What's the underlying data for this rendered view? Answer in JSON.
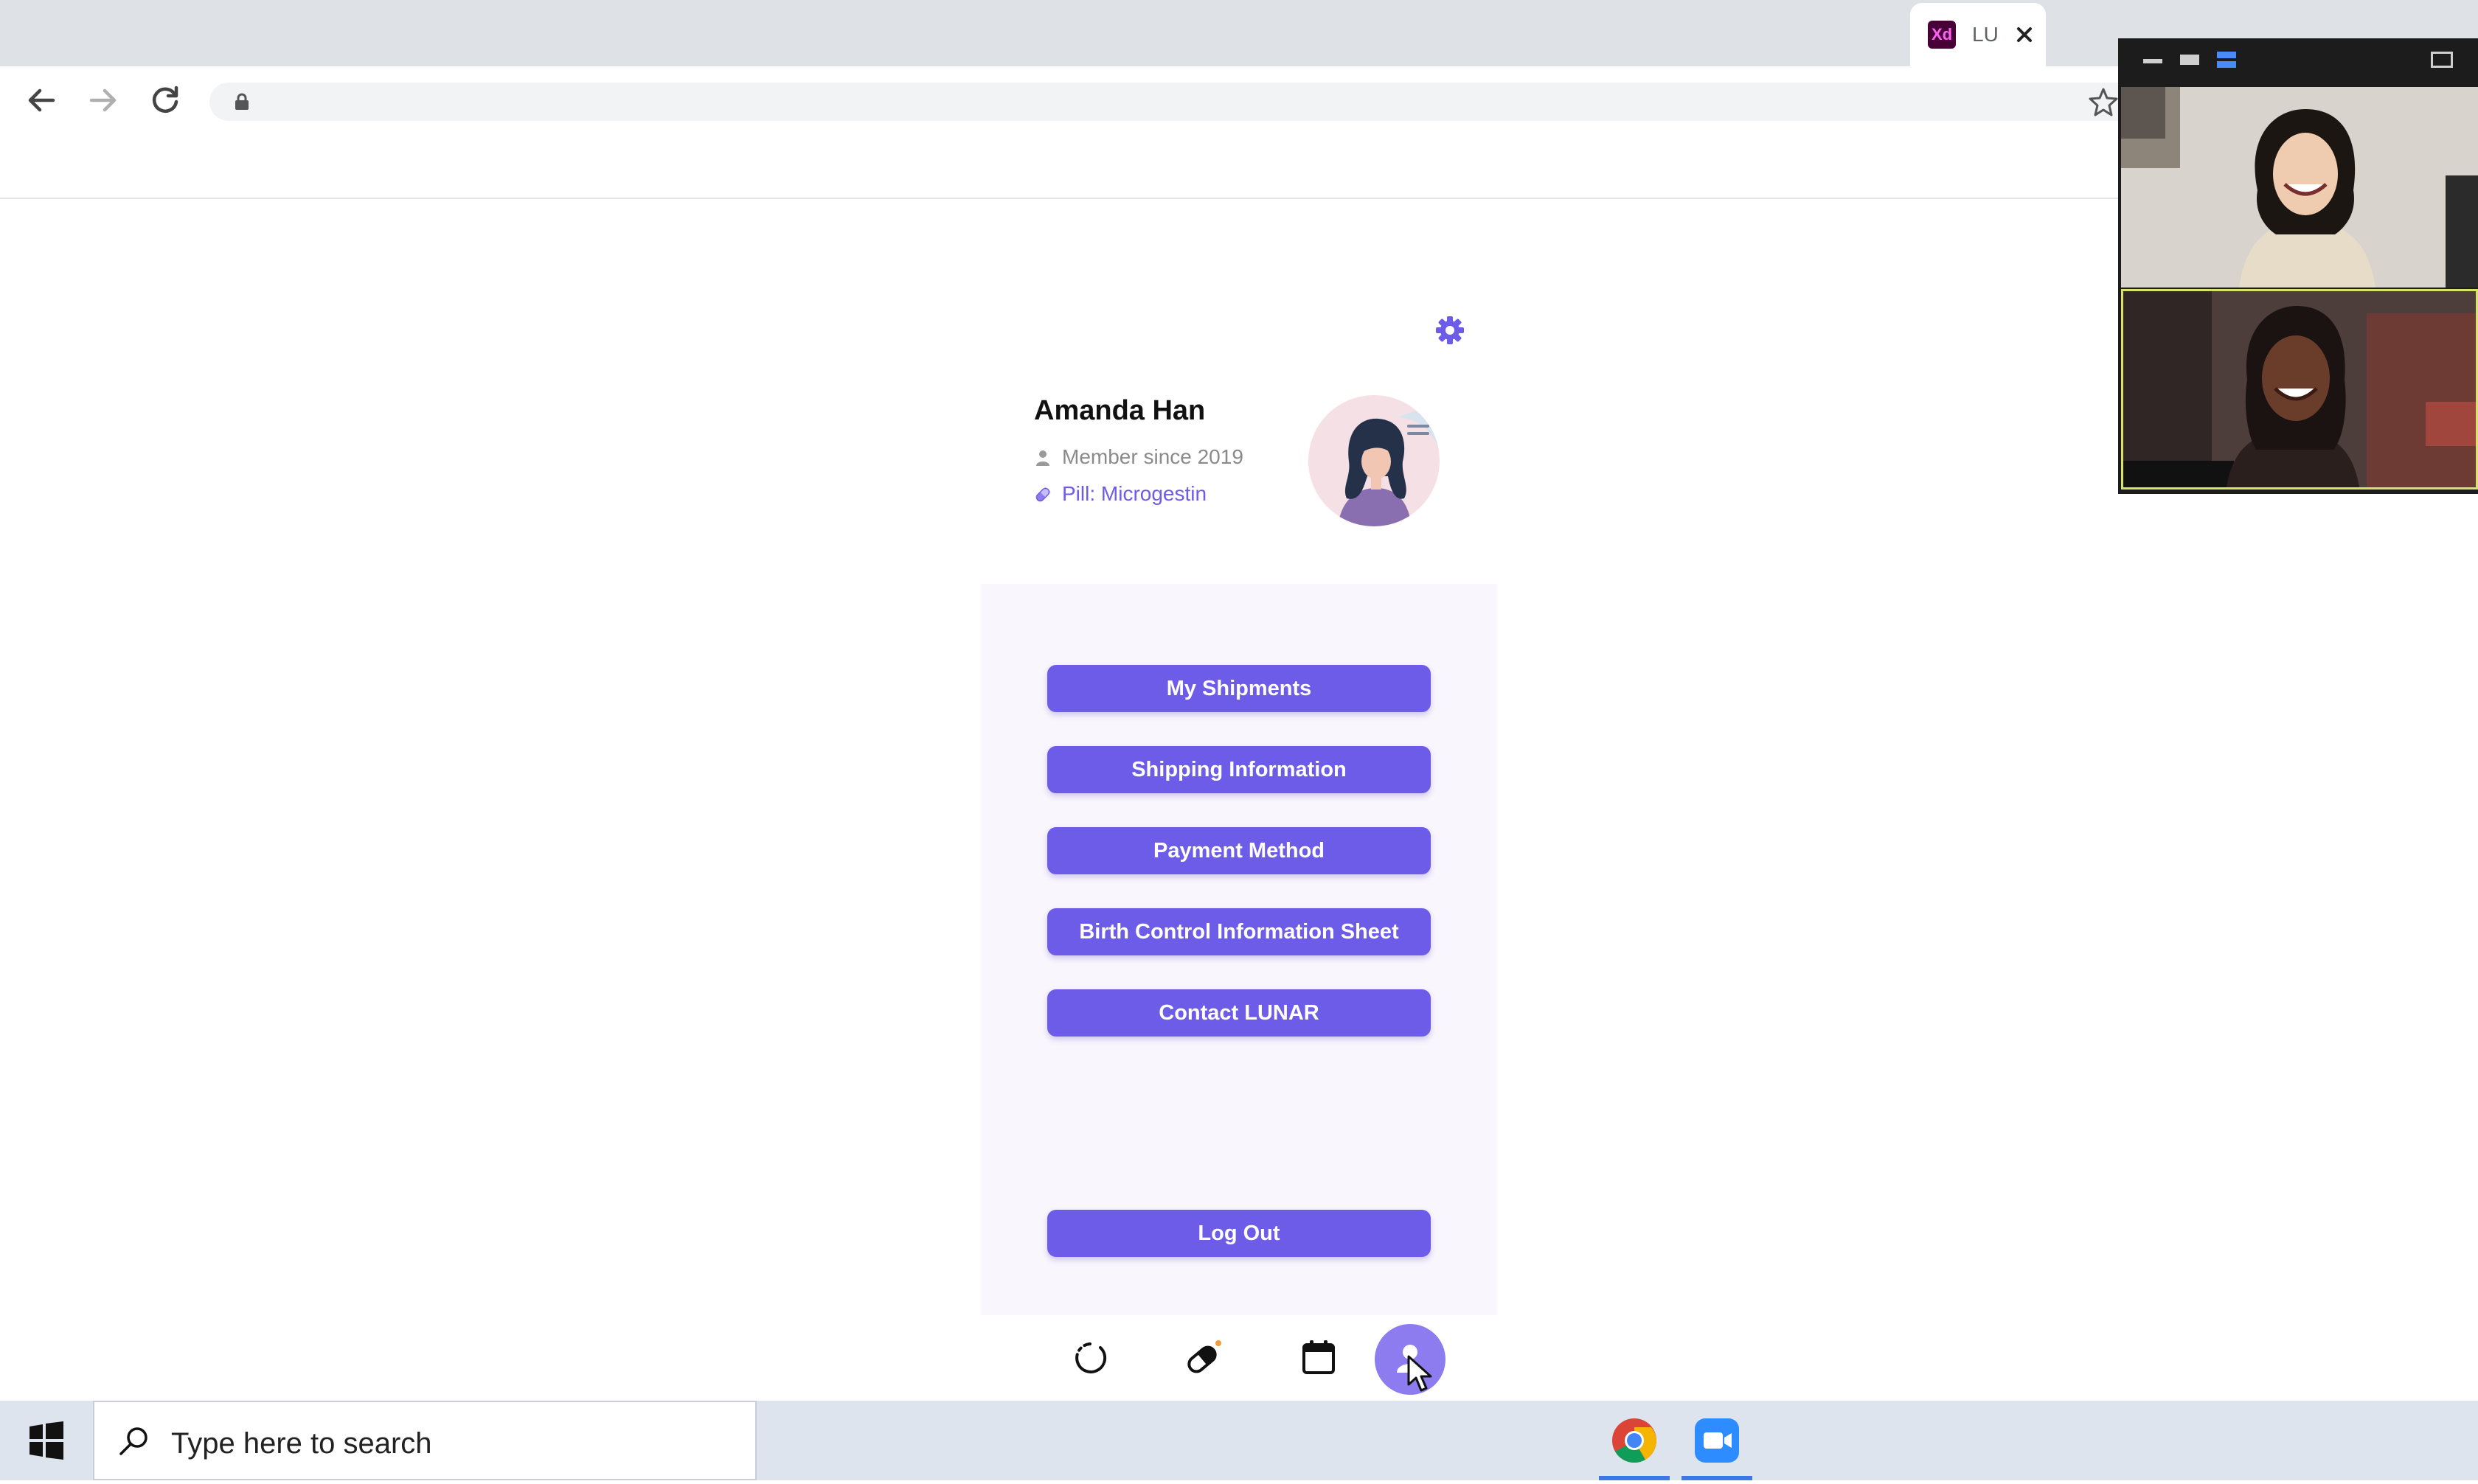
{
  "browser": {
    "tab_title": "LU",
    "tab_favicon_text": "Xd"
  },
  "app": {
    "profile": {
      "name": "Amanda Han",
      "member_since": "Member since 2019",
      "pill": "Pill: Microgestin"
    },
    "menu": [
      {
        "label": "My Shipments"
      },
      {
        "label": "Shipping Information"
      },
      {
        "label": "Payment Method"
      },
      {
        "label": "Birth Control Information Sheet"
      },
      {
        "label": "Contact LUNAR"
      }
    ],
    "logout_label": "Log Out",
    "accent_color": "#6c5ce7"
  },
  "taskbar": {
    "search_placeholder": "Type here to search"
  }
}
